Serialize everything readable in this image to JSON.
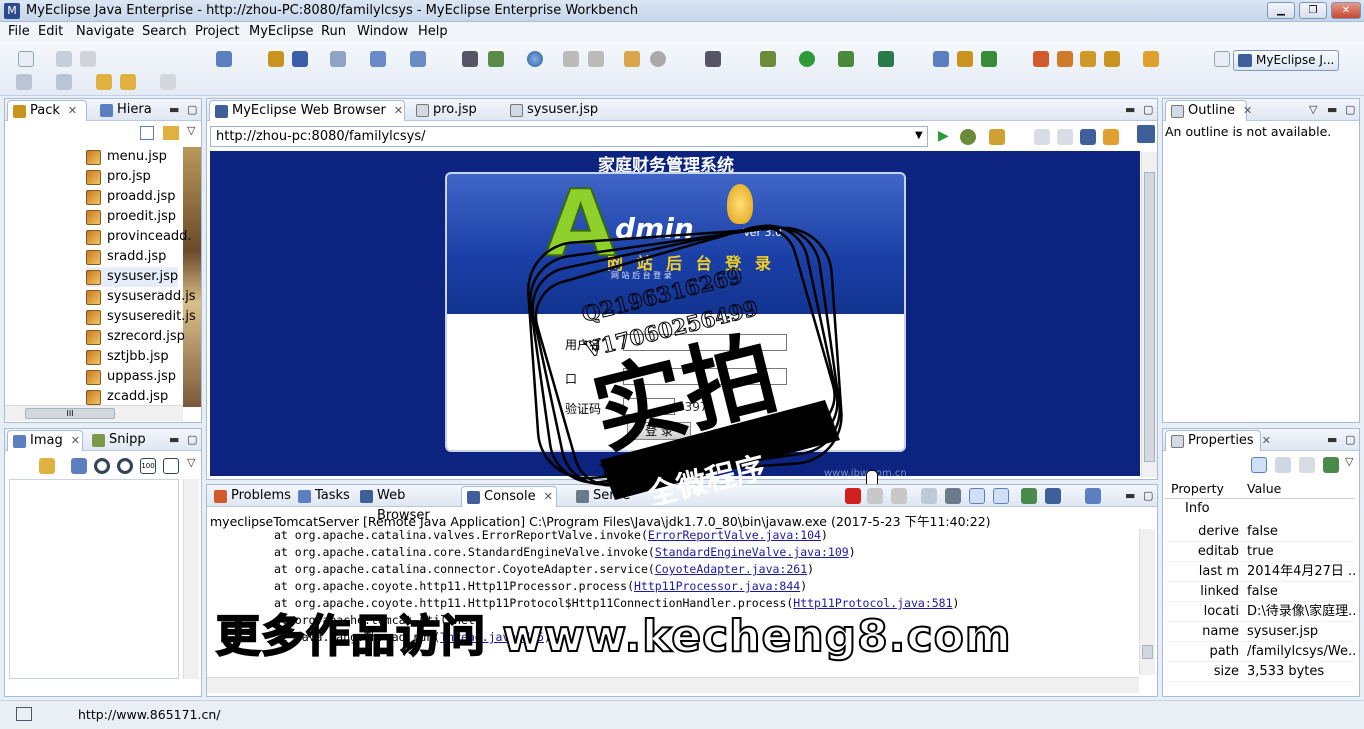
{
  "window": {
    "title": "MyEclipse Java Enterprise - http://zhou-PC:8080/familylcsys - MyEclipse Enterprise Workbench"
  },
  "menu": [
    "File",
    "Edit",
    "Navigate",
    "Search",
    "Project",
    "MyEclipse",
    "Run",
    "Window",
    "Help"
  ],
  "perspective": {
    "label": "MyEclipse J..."
  },
  "left_panel": {
    "tabs": [
      {
        "label": "Pack"
      },
      {
        "label": "Hiera"
      }
    ],
    "files": [
      "menu.jsp",
      "pro.jsp",
      "proadd.jsp",
      "proedit.jsp",
      "provinceadd.",
      "sradd.jsp",
      "sysuser.jsp",
      "sysuseradd.js",
      "sysuseredit.js",
      "szrecord.jsp",
      "sztjbb.jsp",
      "uppass.jsp",
      "zcadd.jsp"
    ],
    "selected_file": "sysuser.jsp",
    "scroll_label": "III"
  },
  "image_panel": {
    "tabs": [
      {
        "label": "Imag"
      },
      {
        "label": "Snipp"
      }
    ]
  },
  "editor": {
    "tabs": [
      {
        "label": "MyEclipse Web Browser"
      },
      {
        "label": "pro.jsp"
      },
      {
        "label": "sysuser.jsp"
      }
    ],
    "url": "http://zhou-pc:8080/familylcsys/"
  },
  "web_page": {
    "heading": "家庭财务管理系统",
    "logo_letter": "A",
    "logo_word": "dmin",
    "version": "Ver 3.0",
    "banner": "网 站 后 台 登 录",
    "banner_small": "网    站    后    台    登    录",
    "username_label": "用户名",
    "password_label": "口",
    "captcha_label": "验证码",
    "captcha_value": "9397",
    "login_button": "登 录",
    "footer_site": "www.ibw.com.cn"
  },
  "outline": {
    "tab": "Outline",
    "message": "An outline is not available."
  },
  "properties": {
    "tab": "Properties",
    "col_property": "Property",
    "col_value": "Value",
    "category": "Info",
    "rows": [
      {
        "k": "derive",
        "v": "false"
      },
      {
        "k": "editab",
        "v": "true"
      },
      {
        "k": "last m",
        "v": "2014年4月27日 ..."
      },
      {
        "k": "linked",
        "v": "false"
      },
      {
        "k": "locati",
        "v": "D:\\待录像\\家庭理..."
      },
      {
        "k": "name",
        "v": "sysuser.jsp"
      },
      {
        "k": "path",
        "v": "/familylcsys/We..."
      },
      {
        "k": "size",
        "v": "3,533  bytes"
      }
    ]
  },
  "bottom_panel": {
    "tabs": [
      {
        "label": "Problems"
      },
      {
        "label": "Tasks"
      },
      {
        "label": "Web Browser"
      },
      {
        "label": "Console"
      },
      {
        "label": "Serve"
      }
    ],
    "console_header": "myeclipseTomcatServer [Remote Java Application] C:\\Program Files\\Java\\jdk1.7.0_80\\bin\\javaw.exe (2017-5-23 下午11:40:22)",
    "lines": [
      {
        "pre": "at org.apache.catalina.valves.ErrorReportValve.invoke(",
        "link": "ErrorReportValve.java:104",
        "post": ")"
      },
      {
        "pre": "at org.apache.catalina.core.StandardEngineValve.invoke(",
        "link": "StandardEngineValve.java:109",
        "post": ")"
      },
      {
        "pre": "at org.apache.catalina.connector.CoyoteAdapter.service(",
        "link": "CoyoteAdapter.java:261",
        "post": ")"
      },
      {
        "pre": "at org.apache.coyote.http11.Http11Processor.process(",
        "link": "Http11Processor.java:844",
        "post": ")"
      },
      {
        "pre": "at org.apache.coyote.http11.Http11Protocol$Http11ConnectionHandler.process(",
        "link": "Http11Protocol.java:581",
        "post": ")"
      },
      {
        "pre": "at org.apache.tomcat.util.net.",
        "link": "",
        "post": ""
      },
      {
        "pre": "at java.lang.Thread.run(",
        "link": "Thread.java:745",
        "post": ")"
      }
    ]
  },
  "status": {
    "text": "http://www.865171.cn/"
  },
  "overlay": {
    "qq": "Q2196316269",
    "v": "V17060256499",
    "stamp_big": "实拍",
    "stamp_ribbon": "全微程序",
    "watermark": "更多作品访问 www.kecheng8.com"
  },
  "colors": {
    "browser_bg": "#0c2380",
    "accent": "#3e5f9a"
  }
}
